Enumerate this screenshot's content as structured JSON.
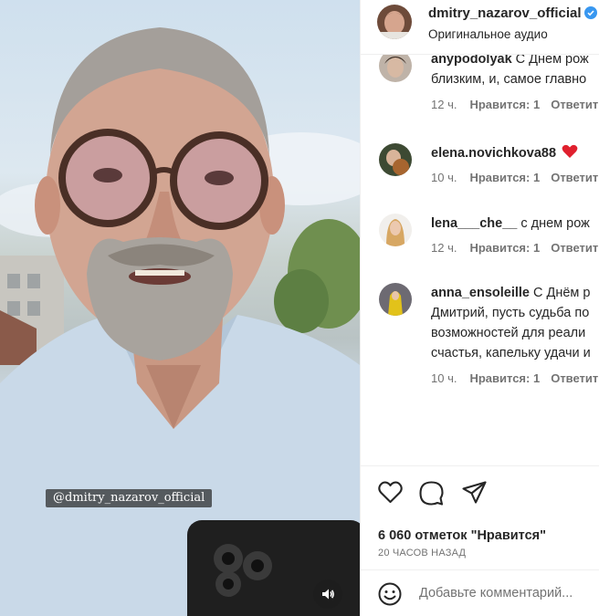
{
  "media": {
    "watermark": "@dmitry_nazarov_official"
  },
  "header": {
    "username": "dmitry_nazarov_official",
    "audio": "Оригинальное аудио"
  },
  "comments": [
    {
      "user": "anypodolyak",
      "lines": [
        "С Днем рож",
        "близким, и, самое главно"
      ],
      "time": "12 ч.",
      "likes": "Нравится: 1",
      "reply": "Ответить"
    },
    {
      "user": "elena.novichkova88",
      "lines": [
        ""
      ],
      "time": "10 ч.",
      "likes": "Нравится: 1",
      "reply": "Ответить",
      "emoji": "red-heart"
    },
    {
      "user": "lena___che__",
      "lines": [
        "с днем рож"
      ],
      "time": "12 ч.",
      "likes": "Нравится: 1",
      "reply": "Ответить"
    },
    {
      "user": "anna_ensoleille",
      "lines": [
        "С Днём р",
        "Дмитрий, пусть судьба по",
        "возможностей для реали",
        "счастья, капельку удачи и"
      ],
      "time": "10 ч.",
      "likes": "Нравится: 1",
      "reply": "Ответить"
    }
  ],
  "stats": {
    "likes": "6 060 отметок \"Нравится\"",
    "time": "20 ЧАСОВ НАЗАД"
  },
  "add_comment": {
    "placeholder": "Добавьте комментарий..."
  },
  "colors": {
    "verified": "#3897f0",
    "heart": "#ed4956",
    "muted": "#737373"
  }
}
